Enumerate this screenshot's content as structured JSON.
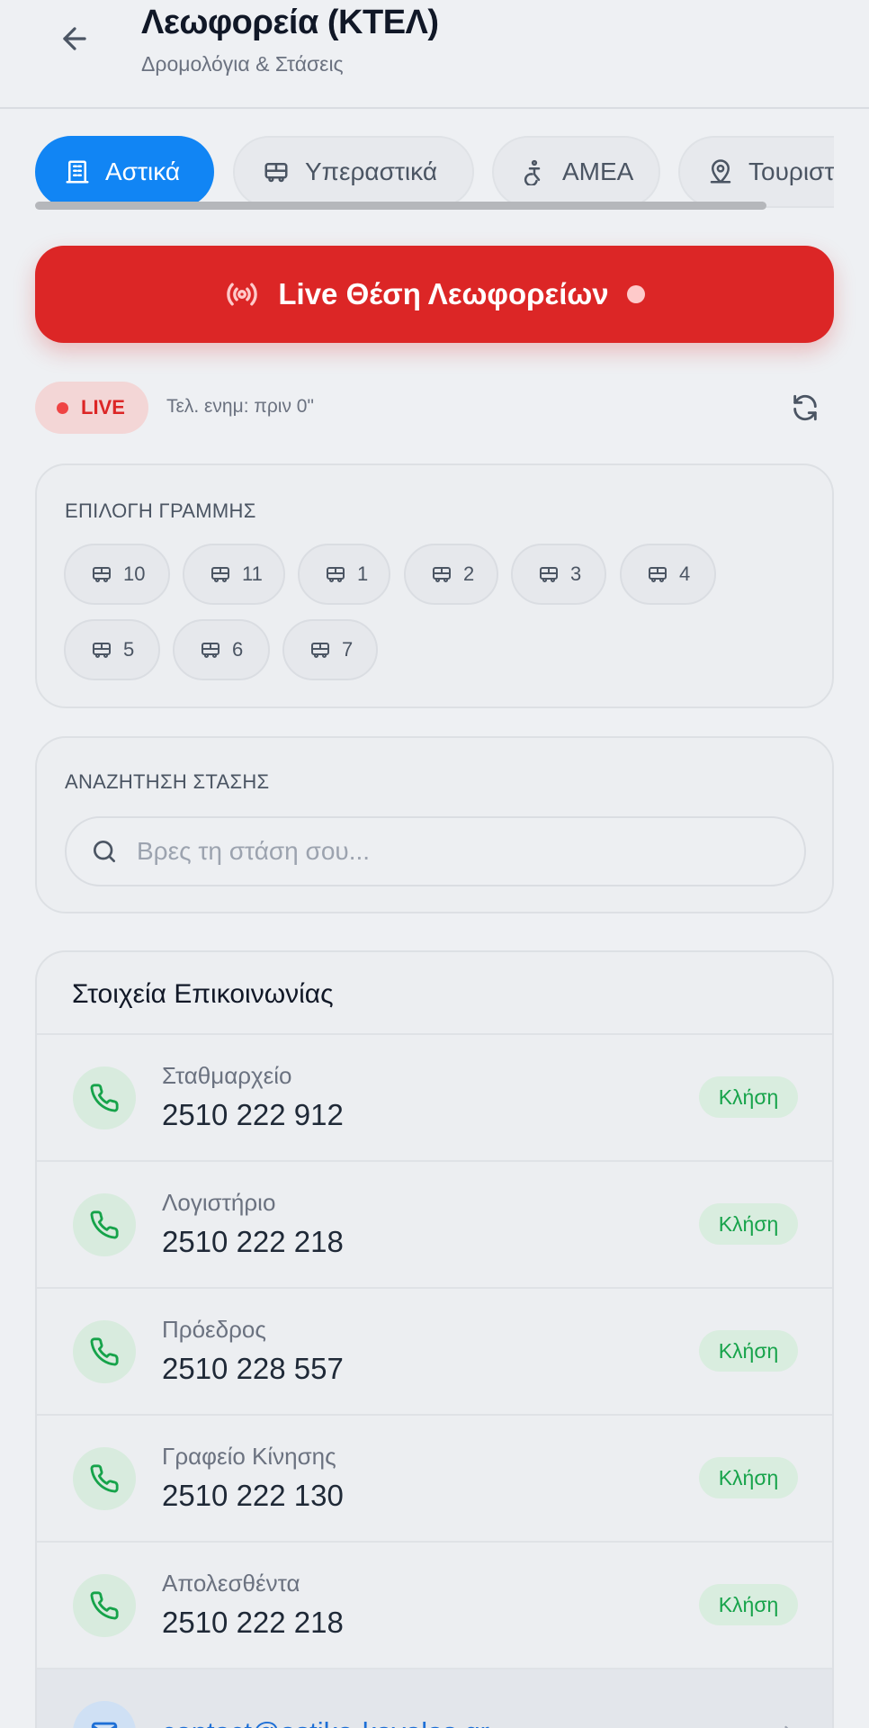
{
  "header": {
    "title": "Λεωφορεία (ΚΤΕΛ)",
    "subtitle": "Δρομολόγια & Στάσεις"
  },
  "tabs": [
    {
      "label": "Αστικά",
      "icon": "building-icon",
      "active": true
    },
    {
      "label": "Υπεραστικά",
      "icon": "bus-icon",
      "active": false
    },
    {
      "label": "ΑΜΕΑ",
      "icon": "accessibility-icon",
      "active": false
    },
    {
      "label": "Τουριστ",
      "icon": "map-pin-icon",
      "active": false
    }
  ],
  "live_button": {
    "label": "Live Θέση Λεωφορείων"
  },
  "status": {
    "badge": "LIVE",
    "updated": "Τελ. ενημ: πριν 0\""
  },
  "lines_section": {
    "label": "ΕΠΙΛΟΓΗ ΓΡΑΜΜΗΣ",
    "lines": [
      "10",
      "11",
      "1",
      "2",
      "3",
      "4",
      "5",
      "6",
      "7"
    ]
  },
  "stop_search": {
    "label": "ΑΝΑΖΗΤΗΣΗ ΣΤΑΣΗΣ",
    "placeholder": "Βρες τη στάση σου...",
    "value": ""
  },
  "contacts": {
    "title": "Στοιχεία Επικοινωνίας",
    "call_label": "Κλήση",
    "items": [
      {
        "label": "Σταθμαρχείο",
        "number": "2510 222 912"
      },
      {
        "label": "Λογιστήριο",
        "number": "2510 222 218"
      },
      {
        "label": "Πρόεδρος",
        "number": "2510 228 557"
      },
      {
        "label": "Γραφείο Κίνησης",
        "number": "2510 222 130"
      },
      {
        "label": "Απολεσθέντα",
        "number": "2510 222 218"
      }
    ],
    "email": "contact@astiko-kavalas.gr"
  },
  "colors": {
    "accent": "#1185f4",
    "live": "#dc2626",
    "call": "#16a34a",
    "link": "#1d6fd6"
  }
}
